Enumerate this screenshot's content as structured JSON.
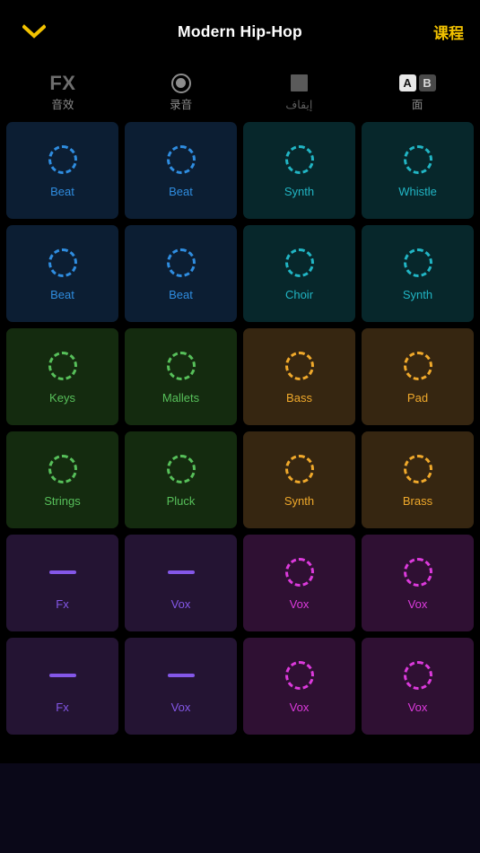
{
  "navbar": {
    "back_icon": "chevron-down-icon",
    "title": "Modern Hip-Hop",
    "lessons_label": "课程",
    "accent_color": "#f2c200"
  },
  "toolbar": {
    "items": [
      {
        "icon": "fx-icon",
        "glyph_text": "FX",
        "label": "音效",
        "dim": false
      },
      {
        "icon": "record-icon",
        "glyph_text": "",
        "label": "录音",
        "dim": false
      },
      {
        "icon": "stop-icon",
        "glyph_text": "",
        "label": "إيقاف",
        "dim": true
      },
      {
        "icon": "ab-toggle-icon",
        "glyph_text": "",
        "label": "面",
        "dim": false,
        "keys": {
          "a": "A",
          "b": "B"
        }
      }
    ]
  },
  "grid": {
    "columns": 4,
    "cells": [
      {
        "label": "Beat",
        "icon": "dashed-circle-icon",
        "theme": "t-blue"
      },
      {
        "label": "Beat",
        "icon": "dashed-circle-icon",
        "theme": "t-blue"
      },
      {
        "label": "Synth",
        "icon": "dashed-circle-icon",
        "theme": "t-teal"
      },
      {
        "label": "Whistle",
        "icon": "dashed-circle-icon",
        "theme": "t-teal"
      },
      {
        "label": "Beat",
        "icon": "dashed-circle-icon",
        "theme": "t-blue"
      },
      {
        "label": "Beat",
        "icon": "dashed-circle-icon",
        "theme": "t-blue"
      },
      {
        "label": "Choir",
        "icon": "dashed-circle-icon",
        "theme": "t-teal"
      },
      {
        "label": "Synth",
        "icon": "dashed-circle-icon",
        "theme": "t-teal"
      },
      {
        "label": "Keys",
        "icon": "dashed-circle-icon",
        "theme": "t-green"
      },
      {
        "label": "Mallets",
        "icon": "dashed-circle-icon",
        "theme": "t-green"
      },
      {
        "label": "Bass",
        "icon": "dashed-circle-icon",
        "theme": "t-orange"
      },
      {
        "label": "Pad",
        "icon": "dashed-circle-icon",
        "theme": "t-orange"
      },
      {
        "label": "Strings",
        "icon": "dashed-circle-icon",
        "theme": "t-green"
      },
      {
        "label": "Pluck",
        "icon": "dashed-circle-icon",
        "theme": "t-green"
      },
      {
        "label": "Synth",
        "icon": "dashed-circle-icon",
        "theme": "t-orange"
      },
      {
        "label": "Brass",
        "icon": "dashed-circle-icon",
        "theme": "t-orange"
      },
      {
        "label": "Fx",
        "icon": "horizontal-bar-icon",
        "theme": "t-violet"
      },
      {
        "label": "Vox",
        "icon": "horizontal-bar-icon",
        "theme": "t-violet"
      },
      {
        "label": "Vox",
        "icon": "dashed-circle-icon",
        "theme": "t-magenta"
      },
      {
        "label": "Vox",
        "icon": "dashed-circle-icon",
        "theme": "t-magenta"
      },
      {
        "label": "Fx",
        "icon": "horizontal-bar-icon",
        "theme": "t-violet"
      },
      {
        "label": "Vox",
        "icon": "horizontal-bar-icon",
        "theme": "t-violet"
      },
      {
        "label": "Vox",
        "icon": "dashed-circle-icon",
        "theme": "t-magenta"
      },
      {
        "label": "Vox",
        "icon": "dashed-circle-icon",
        "theme": "t-magenta"
      }
    ]
  },
  "bottom_panel": {
    "background_color": "#0a0818"
  }
}
